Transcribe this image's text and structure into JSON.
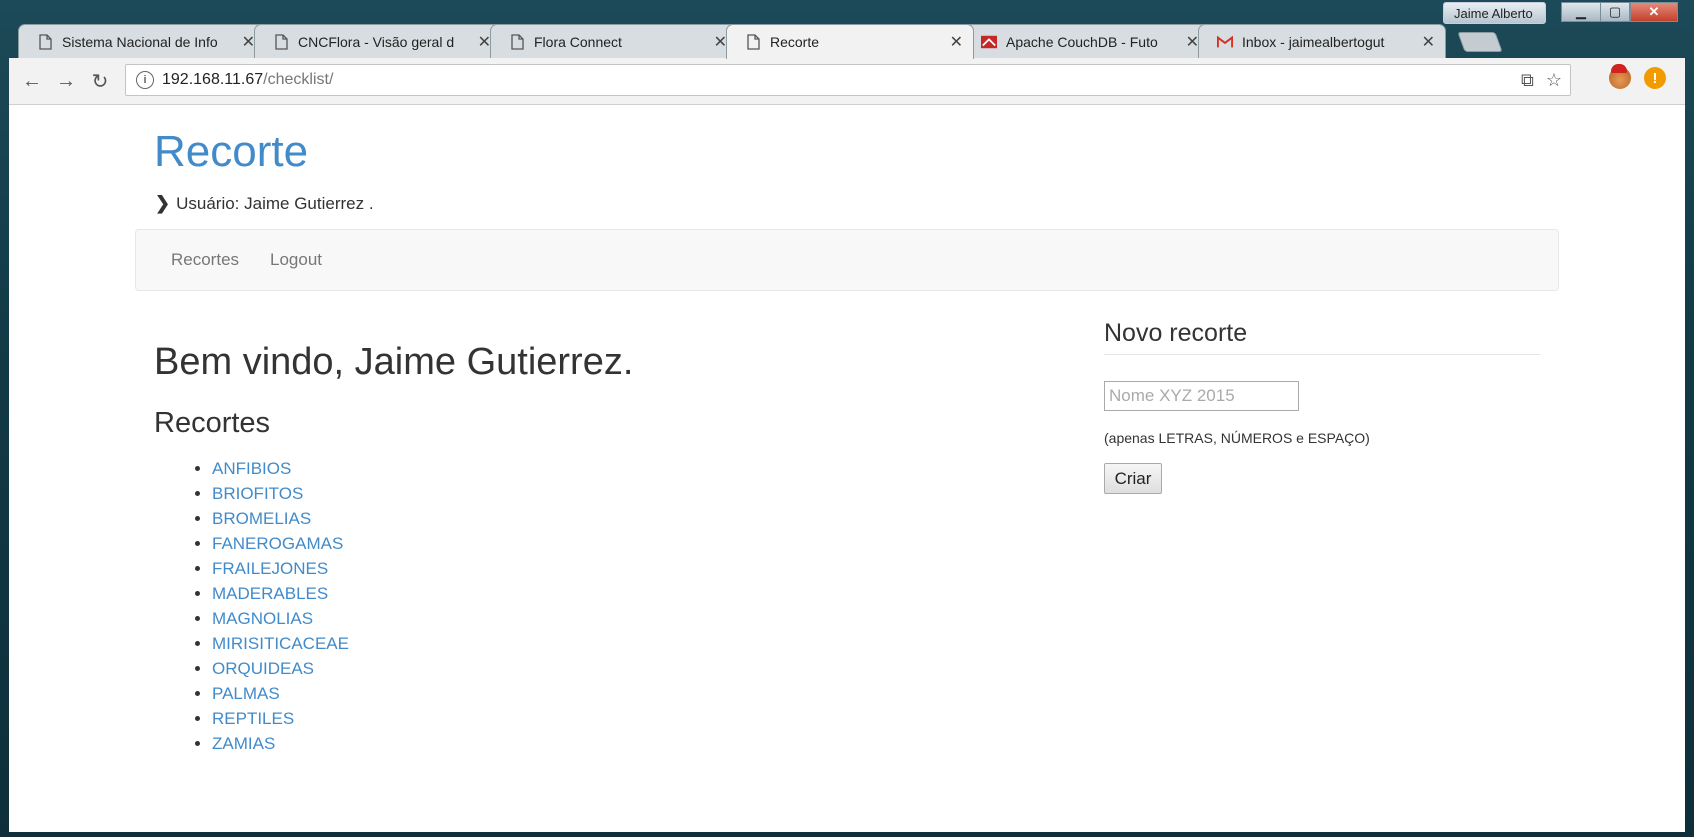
{
  "window": {
    "user_label": "Jaime Alberto",
    "minimize_glyph": "▁",
    "maximize_glyph": "▢",
    "close_glyph": "✕"
  },
  "tabs": [
    {
      "title": "Sistema Nacional de Info",
      "icon": "page-icon",
      "active": false
    },
    {
      "title": "CNCFlora - Visão geral d",
      "icon": "page-icon",
      "active": false
    },
    {
      "title": "Flora Connect",
      "icon": "page-icon",
      "active": false
    },
    {
      "title": "Recorte",
      "icon": "page-icon",
      "active": true
    },
    {
      "title": "Apache CouchDB - Futo",
      "icon": "couchdb-icon",
      "active": false
    },
    {
      "title": "Inbox - jaimealbertogut",
      "icon": "gmail-icon",
      "active": false
    }
  ],
  "toolbar": {
    "url_host": "192.168.11.67",
    "url_path": "/checklist/",
    "back_glyph": "←",
    "forward_glyph": "→",
    "reload_glyph": "↻",
    "translate_glyph": "⧉",
    "star_glyph": "☆",
    "alert_glyph": "!"
  },
  "page": {
    "site_title": "Recorte",
    "user_line": "Usuário: Jaime Gutierrez .",
    "nav": {
      "recortes": "Recortes",
      "logout": "Logout"
    },
    "welcome": "Bem vindo, Jaime Gutierrez.",
    "recortes_heading": "Recortes",
    "recortes": [
      "ANFIBIOS",
      "BRIOFITOS",
      "BROMELIAS",
      "FANEROGAMAS",
      "FRAILEJONES",
      "MADERABLES",
      "MAGNOLIAS",
      "MIRISITICACEAE",
      "ORQUIDEAS",
      "PALMAS",
      "REPTILES",
      "ZAMIAS"
    ],
    "novo": {
      "heading": "Novo recorte",
      "placeholder": "Nome XYZ 2015",
      "help": "(apenas LETRAS, NÚMEROS e ESPAÇO)",
      "button": "Criar"
    }
  },
  "colors": {
    "link": "#428bca",
    "accent_alert": "#f29b00"
  }
}
